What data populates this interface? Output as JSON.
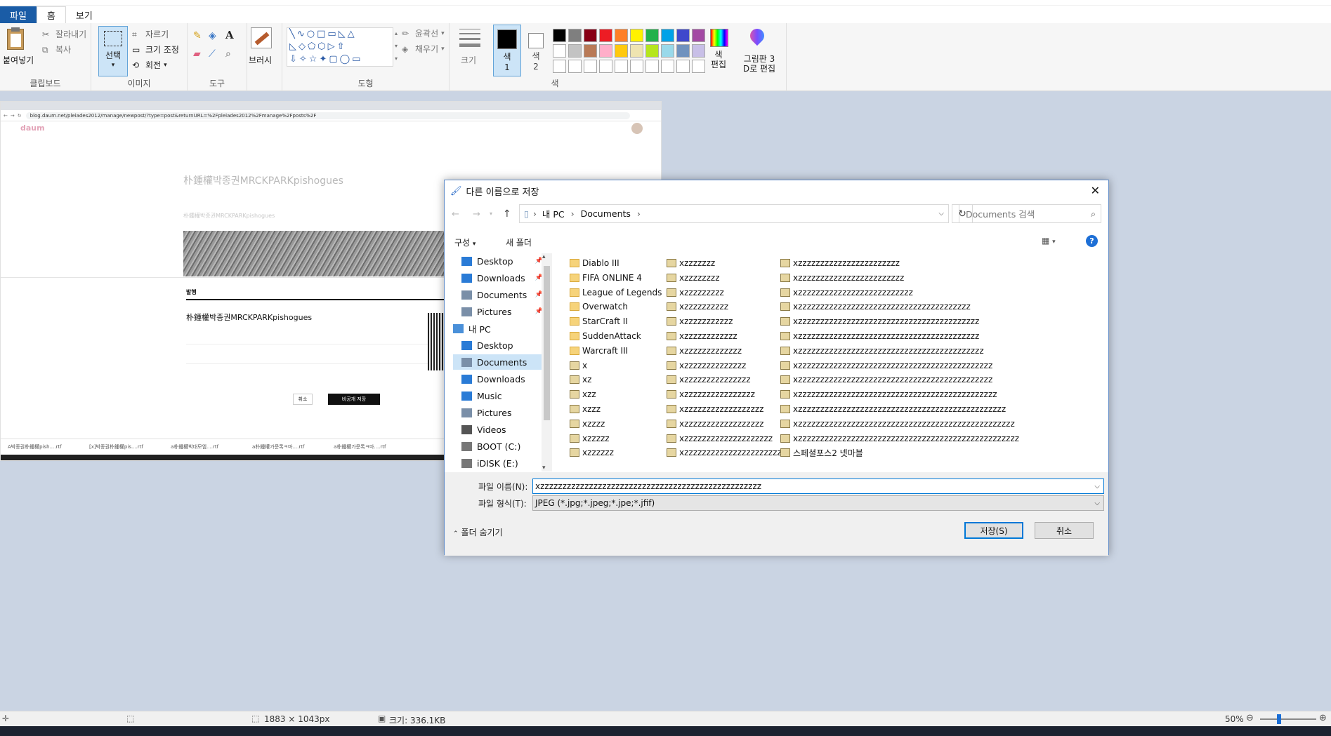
{
  "paint": {
    "menu": {
      "file": "파일",
      "home": "홈",
      "view": "보기"
    },
    "clipboard": {
      "paste": "붙여넣기",
      "cut": "잘라내기",
      "copy": "복사",
      "group": "클립보드"
    },
    "image": {
      "select": "선택",
      "crop": "자르기",
      "resize": "크기 조정",
      "rotate": "회전",
      "group": "이미지"
    },
    "tools": {
      "group": "도구"
    },
    "brush": {
      "label": "브러시"
    },
    "shapes": {
      "outline": "윤곽선",
      "fill": "채우기",
      "group": "도형"
    },
    "size": {
      "label": "크기"
    },
    "colors": {
      "color1": "색\n1",
      "color2": "색\n2",
      "edit": "색\n편집",
      "paint3d": "그림판 3\nD로 편집",
      "group": "색",
      "palette_row1": [
        "#000000",
        "#7f7f7f",
        "#880015",
        "#ed1c24",
        "#ff7f27",
        "#fff200",
        "#22b14c",
        "#00a2e8",
        "#3f48cc",
        "#a349a4"
      ],
      "palette_row2": [
        "#ffffff",
        "#c3c3c3",
        "#b97a57",
        "#ffaec9",
        "#ffc90e",
        "#efe4b0",
        "#b5e61d",
        "#99d9ea",
        "#7092be",
        "#c8bfe7"
      ]
    },
    "status": {
      "dims": "1883 × 1043px",
      "size": "크기: 336.1KB",
      "zoom": "50%"
    }
  },
  "browser": {
    "url": "blog.daum.net/pleiades2012/manage/newpost/?type=post&returnURL=%2Fpleiades2012%2Fmanage%2Fposts%2F",
    "logo": "daum",
    "title": "朴鍾權박종권MRCKPARKpishogues",
    "subtitle": "朴鍾權박종권MRCKPARKpishogues",
    "publish_header": "발행",
    "publish_title": "朴鍾權박종권MRCKPARKpishogues",
    "cancel": "취소",
    "save_private": "비공개 저장",
    "bottom_tabs": [
      "A박종권朴鍾權pish....rtf",
      "[x]박종권朴鍾權pis....rtf",
      "a朴鍾權박대모엠....rtf",
      "a朴鍾權가문록ㅋ마....rtf",
      "a朴鍾權가문록ㅋ마....rtf"
    ]
  },
  "dialog": {
    "title": "다른 이름으로 저장",
    "breadcrumb": [
      "내 PC",
      "Documents"
    ],
    "search_placeholder": "Documents 검색",
    "organize": "구성",
    "new_folder": "새 폴더",
    "nav": [
      {
        "label": "Desktop",
        "pinned": true
      },
      {
        "label": "Downloads",
        "pinned": true
      },
      {
        "label": "Documents",
        "pinned": true
      },
      {
        "label": "Pictures",
        "pinned": true
      },
      {
        "label": "내 PC",
        "pinned": false
      },
      {
        "label": "Desktop",
        "pinned": false
      },
      {
        "label": "Documents",
        "pinned": false
      },
      {
        "label": "Downloads",
        "pinned": false
      },
      {
        "label": "Music",
        "pinned": false
      },
      {
        "label": "Pictures",
        "pinned": false
      },
      {
        "label": "Videos",
        "pinned": false
      },
      {
        "label": "BOOT (C:)",
        "pinned": false
      },
      {
        "label": "iDISK (E:)",
        "pinned": false
      }
    ],
    "col1": [
      {
        "name": "Diablo III",
        "type": "folder"
      },
      {
        "name": "FIFA ONLINE 4",
        "type": "folder"
      },
      {
        "name": "League of Legends",
        "type": "folder"
      },
      {
        "name": "Overwatch",
        "type": "folder"
      },
      {
        "name": "StarCraft II",
        "type": "folder"
      },
      {
        "name": "SuddenAttack",
        "type": "folder"
      },
      {
        "name": "Warcraft III",
        "type": "folder"
      },
      {
        "name": "x",
        "type": "image"
      },
      {
        "name": "xz",
        "type": "image"
      },
      {
        "name": "xzz",
        "type": "image"
      },
      {
        "name": "xzzz",
        "type": "image"
      },
      {
        "name": "xzzzz",
        "type": "image"
      },
      {
        "name": "xzzzzz",
        "type": "image"
      },
      {
        "name": "xzzzzzz",
        "type": "image"
      }
    ],
    "col2": [
      "xzzzzzzz",
      "xzzzzzzzz",
      "xzzzzzzzzz",
      "xzzzzzzzzzz",
      "xzzzzzzzzzzz",
      "xzzzzzzzzzzzz",
      "xzzzzzzzzzzzzz",
      "xzzzzzzzzzzzzzz",
      "xzzzzzzzzzzzzzzz",
      "xzzzzzzzzzzzzzzzz",
      "xzzzzzzzzzzzzzzzzzz",
      "xzzzzzzzzzzzzzzzzzz",
      "xzzzzzzzzzzzzzzzzzzzz",
      "xzzzzzzzzzzzzzzzzzzzzzz"
    ],
    "col3": [
      "xzzzzzzzzzzzzzzzzzzzzzzz",
      "xzzzzzzzzzzzzzzzzzzzzzzzz",
      "xzzzzzzzzzzzzzzzzzzzzzzzzzz",
      "xzzzzzzzzzzzzzzzzzzzzzzzzzzzzzzzzzzzzzzz",
      "xzzzzzzzzzzzzzzzzzzzzzzzzzzzzzzzzzzzzzzzzz",
      "xzzzzzzzzzzzzzzzzzzzzzzzzzzzzzzzzzzzzzzzzz",
      "xzzzzzzzzzzzzzzzzzzzzzzzzzzzzzzzzzzzzzzzzzz",
      "xzzzzzzzzzzzzzzzzzzzzzzzzzzzzzzzzzzzzzzzzzzzz",
      "xzzzzzzzzzzzzzzzzzzzzzzzzzzzzzzzzzzzzzzzzzzzz",
      "xzzzzzzzzzzzzzzzzzzzzzzzzzzzzzzzzzzzzzzzzzzzzz",
      "xzzzzzzzzzzzzzzzzzzzzzzzzzzzzzzzzzzzzzzzzzzzzzzz",
      "xzzzzzzzzzzzzzzzzzzzzzzzzzzzzzzzzzzzzzzzzzzzzzzzzz",
      "xzzzzzzzzzzzzzzzzzzzzzzzzzzzzzzzzzzzzzzzzzzzzzzzzzz",
      "스페셜포스2 넷마블"
    ],
    "filename_label": "파일 이름(N):",
    "filename_value": "xzzzzzzzzzzzzzzzzzzzzzzzzzzzzzzzzzzzzzzzzzzzzzzzzzz",
    "filetype_label": "파일 형식(T):",
    "filetype_value": "JPEG (*.jpg;*.jpeg;*.jpe;*.jfif)",
    "hide_folders": "폴더 숨기기",
    "save": "저장(S)",
    "cancel": "취소"
  }
}
